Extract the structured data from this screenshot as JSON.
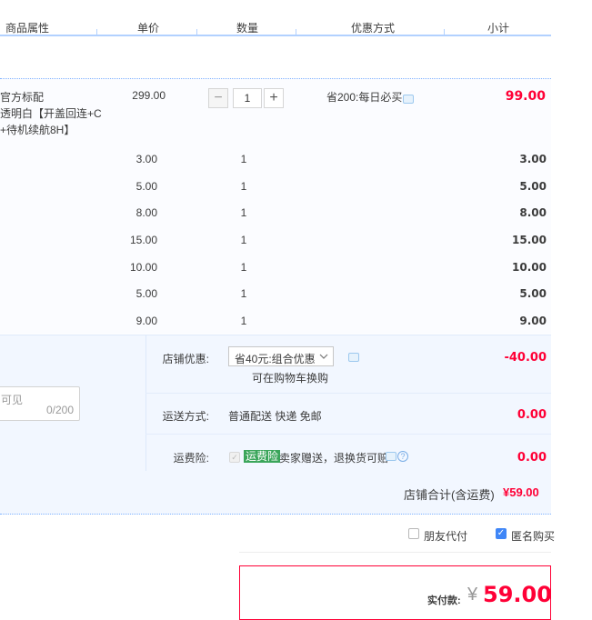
{
  "header": {
    "attr": "商品属性",
    "price": "单价",
    "qty": "数量",
    "promo": "优惠方式",
    "subtotal": "小计"
  },
  "main_item": {
    "name_lines": [
      "官方标配",
      "透明白【开盖回连+C",
      "+待机续航8H】"
    ],
    "price": "299.00",
    "qty": "1",
    "minus": "−",
    "plus": "+",
    "promo": "省200:每日必买",
    "subtotal": "99.00"
  },
  "extra_items": [
    {
      "price": "3.00",
      "qty": "1",
      "subtotal": "3.00"
    },
    {
      "price": "5.00",
      "qty": "1",
      "subtotal": "5.00"
    },
    {
      "price": "8.00",
      "qty": "1",
      "subtotal": "8.00"
    },
    {
      "price": "15.00",
      "qty": "1",
      "subtotal": "15.00"
    },
    {
      "price": "10.00",
      "qty": "1",
      "subtotal": "10.00"
    },
    {
      "price": "5.00",
      "qty": "1",
      "subtotal": "5.00"
    },
    {
      "price": "9.00",
      "qty": "1",
      "subtotal": "9.00"
    }
  ],
  "shop": {
    "memo_placeholder": "可见",
    "memo_count": "0/200",
    "discount_label": "店铺优惠:",
    "discount_select": "省40元:组合优惠",
    "discount_note": "可在购物车换购",
    "discount_amount": "-40.00",
    "delivery_label": "运送方式:",
    "delivery_value": "普通配送 快递 免邮",
    "delivery_amount": "0.00",
    "insurance_label": "运费险:",
    "insurance_tag": "运费险",
    "insurance_text": "卖家赠送，退换货可赔",
    "insurance_amount": "0.00",
    "total_label": "店铺合计(含运费)",
    "total_value": "¥59.00"
  },
  "options": {
    "friend_pay": "朋友代付",
    "anonymous": "匿名购买"
  },
  "payment": {
    "label": "实付款:",
    "currency": "¥",
    "amount": "59.00"
  },
  "colors": {
    "accent_red": "#ff0036",
    "accent_blue": "#3f86f7",
    "section_bg": "#f2f7ff",
    "insurance_green": "#3aa55a"
  }
}
